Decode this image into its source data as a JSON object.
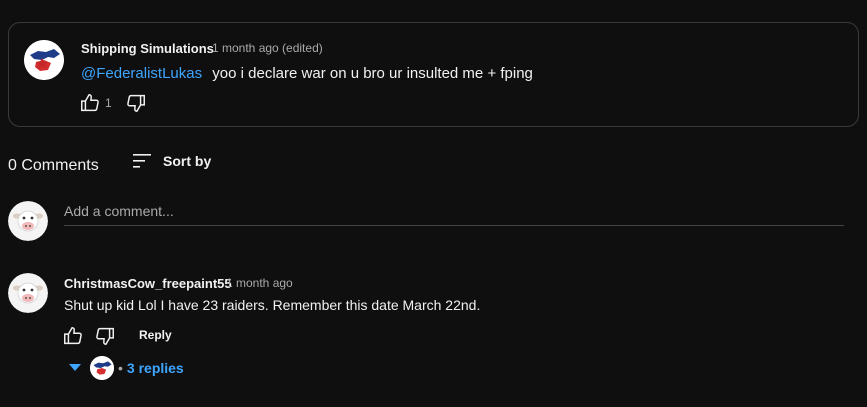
{
  "highlighted_comment": {
    "author": "Shipping Simulations",
    "time": "1 month ago (edited)",
    "mention": "@FederalistLukas",
    "text": "yoo i declare war on u bro ur insulted me + fping",
    "like_count": "1",
    "avatar_icon": "flag-map-avatar-icon"
  },
  "comments_header": {
    "count_label": "0 Comments",
    "sort_label": "Sort by"
  },
  "add_comment": {
    "placeholder": "Add a comment...",
    "avatar_icon": "cow-avatar-icon"
  },
  "comments": [
    {
      "author": "ChristmasCow_freepaint55",
      "time": "1 month ago",
      "text": "Shut up kid Lol I have 23 raiders. Remember this date March 22nd.",
      "reply_label": "Reply",
      "replies_label": "3 replies",
      "avatar_icon": "cow-avatar-icon"
    }
  ],
  "colors": {
    "background": "#0f0f0f",
    "link_blue": "#3ea6ff",
    "muted_text": "#aaaaaa"
  }
}
